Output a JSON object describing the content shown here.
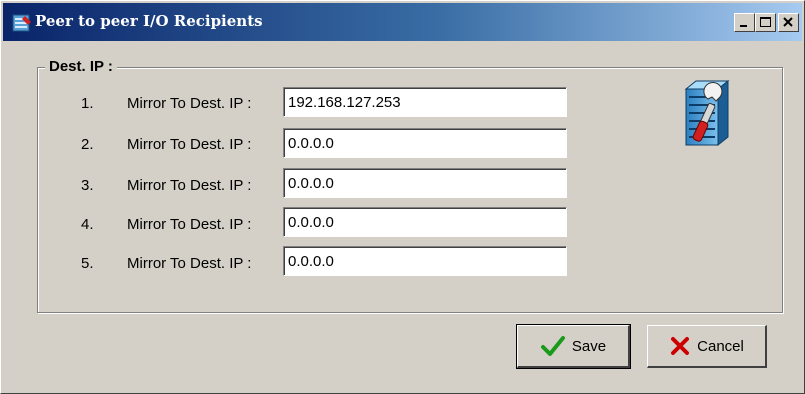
{
  "window": {
    "title": "Peer to peer I/O Recipients",
    "controls": [
      "minimize-icon",
      "maximize-icon",
      "close-icon"
    ]
  },
  "group": {
    "label": "Dest. IP :"
  },
  "rows": [
    {
      "number": "1.",
      "label": "Mirror To Dest. IP :",
      "value": "192.168.127.253"
    },
    {
      "number": "2.",
      "label": "Mirror To Dest. IP :",
      "value": "0.0.0.0"
    },
    {
      "number": "3.",
      "label": "Mirror To Dest. IP :",
      "value": "0.0.0.0"
    },
    {
      "number": "4.",
      "label": "Mirror To Dest. IP :",
      "value": "0.0.0.0"
    },
    {
      "number": "5.",
      "label": "Mirror To Dest. IP :",
      "value": "0.0.0.0"
    }
  ],
  "buttons": {
    "save": {
      "label": "Save",
      "icon": "checkmark-icon",
      "icon_color": "#1a9a1a"
    },
    "cancel": {
      "label": "Cancel",
      "icon": "x-icon",
      "icon_color": "#cc0000"
    }
  },
  "colors": {
    "titlebar_start": "#0a246a",
    "titlebar_end": "#a6caf0",
    "face": "#d4d0c8"
  }
}
